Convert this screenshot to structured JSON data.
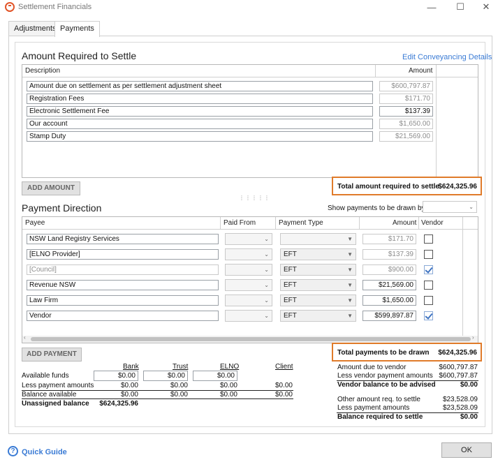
{
  "window": {
    "title": "Settlement Financials"
  },
  "tabs": [
    {
      "label": "Adjustments"
    },
    {
      "label": "Payments"
    }
  ],
  "amount_required": {
    "title": "Amount Required to Settle",
    "edit_link": "Edit Conveyancing Details",
    "col_description": "Description",
    "col_amount": "Amount",
    "rows": [
      {
        "description": "Amount due on settlement as per settlement adjustment sheet",
        "amount": "$600,797.87"
      },
      {
        "description": "Registration Fees",
        "amount": "$171.70"
      },
      {
        "description": "Electronic Settlement Fee",
        "amount": "$137.39"
      },
      {
        "description": "Our account",
        "amount": "$1,650.00"
      },
      {
        "description": "Stamp Duty",
        "amount": "$21,569.00"
      }
    ],
    "add_button": "ADD AMOUNT",
    "total_label": "Total amount required to settle",
    "total_value": "$624,325.96"
  },
  "payment_direction": {
    "title": "Payment Direction",
    "show_label": "Show payments to be drawn by",
    "show_value": "",
    "cols": {
      "payee": "Payee",
      "paid_from": "Paid From",
      "payment_type": "Payment Type",
      "amount": "Amount",
      "vendor": "Vendor"
    },
    "rows": [
      {
        "payee": "NSW Land Registry Services",
        "paid_from": "",
        "payment_type": "",
        "amount": "$171.70",
        "vendor": false
      },
      {
        "payee": "[ELNO Provider]",
        "paid_from": "",
        "payment_type": "EFT",
        "amount": "$137.39",
        "vendor": false
      },
      {
        "payee": "[Council]",
        "paid_from": "",
        "payment_type": "EFT",
        "amount": "$900.00",
        "vendor": true
      },
      {
        "payee": "Revenue NSW",
        "paid_from": "",
        "payment_type": "EFT",
        "amount": "$21,569.00",
        "vendor": false
      },
      {
        "payee": "Law Firm",
        "paid_from": "",
        "payment_type": "EFT",
        "amount": "$1,650.00",
        "vendor": false
      },
      {
        "payee": "Vendor",
        "paid_from": "",
        "payment_type": "EFT",
        "amount": "$599,897.87",
        "vendor": true
      }
    ],
    "add_button": "ADD PAYMENT",
    "total_label": "Total payments to be drawn",
    "total_value": "$624,325.96"
  },
  "funds": {
    "cols": {
      "bank": "Bank",
      "trust": "Trust",
      "elno": "ELNO",
      "client": "Client"
    },
    "available_label": "Available funds",
    "available": {
      "bank": "$0.00",
      "trust": "$0.00",
      "elno": "$0.00"
    },
    "less_label": "Less payment amounts",
    "less": {
      "bank": "$0.00",
      "trust": "$0.00",
      "elno": "$0.00",
      "client": "$0.00"
    },
    "balance_label": "Balance available",
    "balance": {
      "bank": "$0.00",
      "trust": "$0.00",
      "elno": "$0.00",
      "client": "$0.00"
    },
    "unassigned_label": "Unassigned balance",
    "unassigned_value": "$624,325.96"
  },
  "summary": {
    "due_vendor_label": "Amount due to vendor",
    "due_vendor": "$600,797.87",
    "less_vendor_label": "Less vendor payment amounts",
    "less_vendor": "$600,797.87",
    "vendor_balance_label": "Vendor balance to be advised",
    "vendor_balance": "$0.00",
    "other_label": "Other amount req. to settle",
    "other": "$23,528.09",
    "less_pay_label": "Less payment amounts",
    "less_pay": "$23,528.09",
    "balance_req_label": "Balance required to settle",
    "balance_req": "$0.00"
  },
  "footer": {
    "quick_guide": "Quick Guide",
    "ok": "OK"
  },
  "colors": {
    "accent": "#e07b2a",
    "link": "#3a7bd5"
  }
}
